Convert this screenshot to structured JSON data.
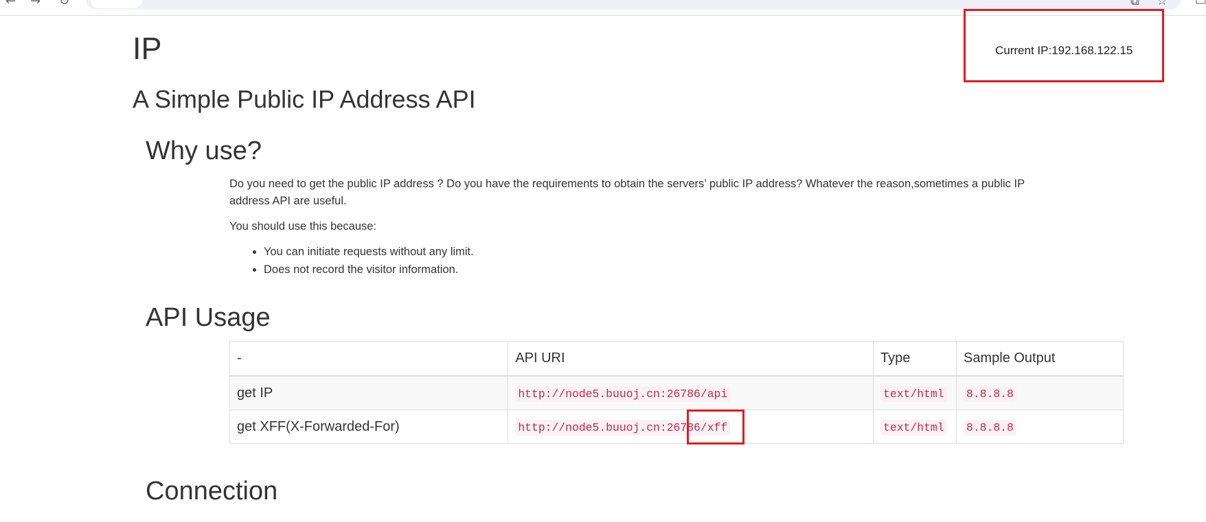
{
  "browser": {
    "back_icon": "arrow-left-icon",
    "forward_icon": "arrow-right-icon",
    "reload_icon": "reload-icon",
    "translate_icon": "translate-icon",
    "bookmark_icon": "star-icon"
  },
  "page": {
    "title": "IP",
    "subtitle": "A Simple Public IP Address API",
    "current_ip": "Current IP:192.168.122.15"
  },
  "why": {
    "heading": "Why use?",
    "paragraph": "Do you need to get the public IP address ? Do you have the requirements to obtain the servers’ public IP address? Whatever the reason,sometimes a public IP address API are useful.",
    "intro": "You should use this because:",
    "bullets": [
      "You can initiate requests without any limit.",
      "Does not record the visitor information."
    ]
  },
  "api_usage": {
    "heading": "API Usage",
    "columns": [
      "-",
      "API URI",
      "Type",
      "Sample Output"
    ],
    "rows": [
      {
        "name": "get IP",
        "uri": "http://node5.buuoj.cn:26786/api",
        "type": "text/html",
        "sample": "8.8.8.8"
      },
      {
        "name": "get XFF(X-Forwarded-For)",
        "uri": "http://node5.buuoj.cn:26786/xff",
        "type": "text/html",
        "sample": "8.8.8.8"
      }
    ]
  },
  "connection": {
    "heading": "Connection"
  },
  "colors": {
    "text": "#333333",
    "code_text": "#c7254e",
    "code_bg": "#f9f2f4",
    "annotation_red": "#e3191e",
    "table_border": "#dddddd",
    "stripe": "#f9f9f9"
  }
}
